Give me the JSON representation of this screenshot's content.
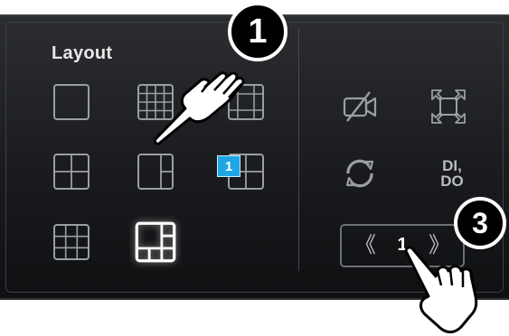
{
  "panel": {
    "section_title": "Layout",
    "layout_options": [
      {
        "name": "single",
        "selected": false
      },
      {
        "name": "grid-4x4",
        "selected": false
      },
      {
        "name": "grid-3x3-alt",
        "selected": false
      },
      {
        "name": "grid-2x2",
        "selected": false
      },
      {
        "name": "split-1-plus-2",
        "selected": false
      },
      {
        "name": "split-1-plus-3",
        "selected": false
      },
      {
        "name": "grid-3x3",
        "selected": false
      },
      {
        "name": "big-plus-5",
        "selected": true
      }
    ],
    "page_badge": "1",
    "tools": {
      "camera_off": "camera-off-icon",
      "fullscreen": "fullscreen-icon",
      "refresh": "refresh-icon",
      "dido_line1": "DI,",
      "dido_line2": "DO"
    },
    "pager": {
      "prev": "《",
      "page": "1",
      "next": "》"
    }
  },
  "callouts": {
    "first": "1",
    "third": "3"
  },
  "colors": {
    "accent": "#1ea5e3",
    "icon": "#9a9ea5",
    "selected": "#ffffff"
  }
}
